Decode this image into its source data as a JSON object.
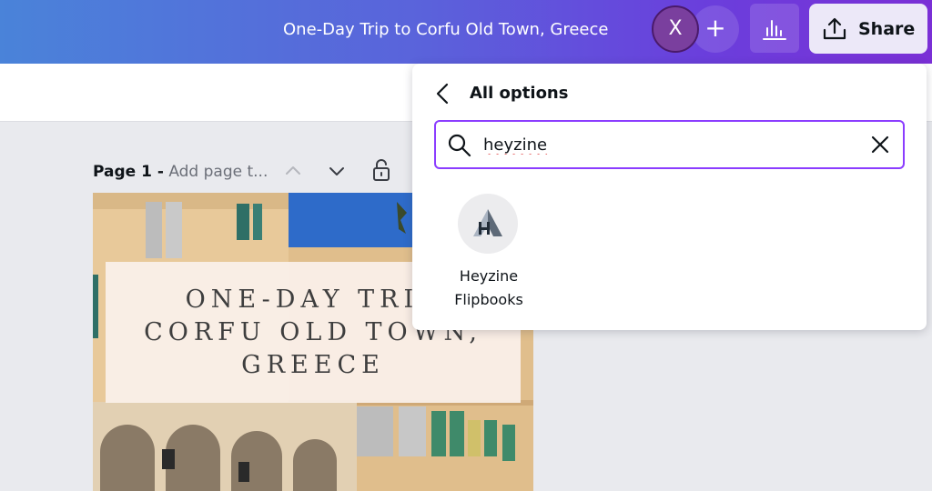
{
  "topbar": {
    "doc_title": "One-Day Trip to Corfu Old Town, Greece",
    "avatar_initial": "X",
    "add_symbol": "+",
    "share_label": "Share",
    "gradient_colors": [
      "#4a83d9",
      "#6a3fdc",
      "#7a2fd6"
    ],
    "icons": [
      "plus-icon",
      "bar-chart-icon",
      "upload-icon"
    ]
  },
  "page_header": {
    "page_label": "Page 1 -",
    "title_placeholder": "Add page t...",
    "icons": [
      "chevron-up-icon",
      "chevron-down-icon",
      "lock-icon"
    ]
  },
  "design": {
    "title_lines": [
      "ONE-DAY TRIP",
      "CORFU OLD TOWN,",
      "GREECE"
    ]
  },
  "panel": {
    "title": "All options",
    "search_value": "heyzine",
    "accent_color": "#8b3dff",
    "icons": [
      "back-chevron-icon",
      "search-icon",
      "close-icon"
    ],
    "results": [
      {
        "name_line1": "Heyzine",
        "name_line2": "Flipbooks",
        "logo_icon": "heyzine-logo-icon"
      }
    ]
  }
}
